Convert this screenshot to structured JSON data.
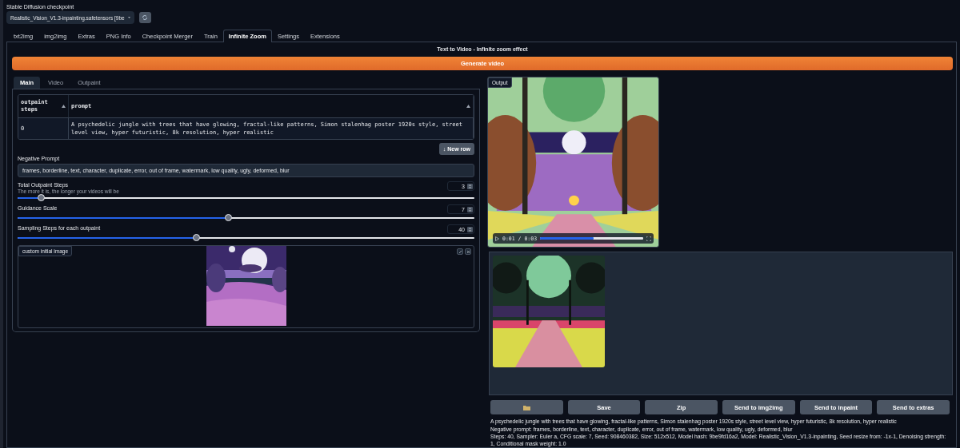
{
  "checkpoint": {
    "label": "Stable Diffusion checkpoint",
    "value": "Realistic_Vision_V1.3-inpainting.safetensors [9be"
  },
  "tabs": [
    {
      "label": "txt2img",
      "selected": false
    },
    {
      "label": "img2img",
      "selected": false
    },
    {
      "label": "Extras",
      "selected": false
    },
    {
      "label": "PNG Info",
      "selected": false
    },
    {
      "label": "Checkpoint Merger",
      "selected": false
    },
    {
      "label": "Train",
      "selected": false
    },
    {
      "label": "Infinite Zoom",
      "selected": true
    },
    {
      "label": "Settings",
      "selected": false
    },
    {
      "label": "Extensions",
      "selected": false
    }
  ],
  "heading": "Text to Video - Infinite zoom effect",
  "generate_button": "Generate video",
  "subtabs": [
    {
      "label": "Main",
      "selected": true
    },
    {
      "label": "Video",
      "selected": false
    },
    {
      "label": "Outpaint",
      "selected": false
    }
  ],
  "prompts_table": {
    "columns": [
      "outpaint steps",
      "prompt"
    ],
    "rows": [
      [
        "0",
        "A psychedelic jungle with trees that have glowing, fractal-like patterns, Simon stalenhag poster 1920s style, street level view, hyper futuristic, 8k resolution, hyper realistic"
      ]
    ]
  },
  "new_row_button": "↓ New row",
  "negative_prompt": {
    "label": "Negative Prompt",
    "value": "frames, borderline, text, character, duplicate, error, out of frame, watermark, low quality, ugly, deformed, blur"
  },
  "sliders": [
    {
      "label": "Total Outpaint Steps",
      "hint": "The more it is, the longer your videos will be",
      "value": "3",
      "level": 0.05
    },
    {
      "label": "Guidance Scale",
      "value": "7",
      "level": 0.46
    },
    {
      "label": "Sampling Steps for each outpaint",
      "value": "40",
      "level": 0.39
    }
  ],
  "custom_image": {
    "label": "custom initial image"
  },
  "output": {
    "label": "Output",
    "time": "0:01 / 0:03",
    "level": 0.52
  },
  "gallery_buttons": [
    {
      "kind": "folder"
    },
    {
      "kind": "text",
      "label": "Save"
    },
    {
      "kind": "text",
      "label": "Zip"
    },
    {
      "kind": "text",
      "label": "Send to img2img"
    },
    {
      "kind": "text",
      "label": "Send to inpaint"
    },
    {
      "kind": "text",
      "label": "Send to extras"
    }
  ],
  "info": [
    "A psychedelic jungle with trees that have glowing, fractal-like patterns, Simon stalenhag poster 1920s style, street level view, hyper futuristic, 8k resolution, hyper realistic",
    "Negative prompt: frames, borderline, text, character, duplicate, error, out of frame, watermark, low quality, ugly, deformed, blur",
    "Steps: 40, Sampler: Euler a, CFG scale: 7, Seed: 908460382, Size: 512x512, Model hash: 9be9fd16a2, Model: Realistic_Vision_V1.3-inpainting, Seed resize from: -1x-1, Denoising strength: 1, Conditional mask weight: 1.0"
  ]
}
